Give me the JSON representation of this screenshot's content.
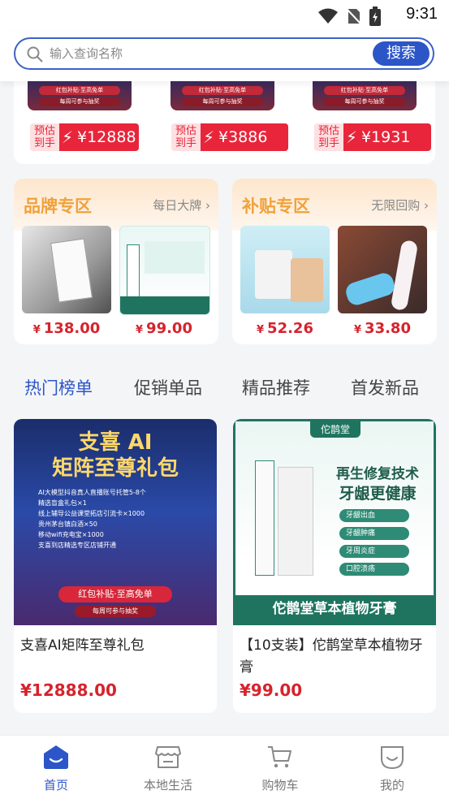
{
  "status_bar": {
    "time": "9:31"
  },
  "search": {
    "placeholder": "输入查询名称",
    "button_label": "搜索"
  },
  "top_promos": [
    {
      "pill1": "红包补贴·至高免单",
      "pill2": "每周可参与抽奖",
      "est_label": "预估到手",
      "price": "¥12888"
    },
    {
      "pill1": "红包补贴·至高免单",
      "pill2": "每周可参与抽奖",
      "est_label": "预估到手",
      "price": "¥3886"
    },
    {
      "pill1": "红包补贴·至高免单",
      "pill2": "每周可参与抽奖",
      "est_label": "预估到手",
      "price": "¥1931"
    }
  ],
  "zones": [
    {
      "title": "品牌专区",
      "link": "每日大牌",
      "items": [
        {
          "price": "138.00"
        },
        {
          "price": "99.00"
        }
      ]
    },
    {
      "title": "补贴专区",
      "link": "无限回购",
      "items": [
        {
          "price": "52.26"
        },
        {
          "price": "33.80"
        }
      ]
    }
  ],
  "currency": "¥",
  "tabs": [
    "热门榜单",
    "促销单品",
    "精品推荐",
    "首发新品"
  ],
  "products": [
    {
      "title": "支喜AI矩阵至尊礼包",
      "price": "¥12888.00",
      "banner_title_1": "支喜 AI",
      "banner_title_2": "矩阵至尊礼包",
      "lines": [
        "AI大模型抖音真人直播账号托管5-8个",
        "精选盲盒礼包×1",
        "线上辅导公益课堂拓店引流卡×1000",
        "贵州茅台镇白酒×50",
        "移动wifi充电宝×1000",
        "支喜到店精选专区店铺开通"
      ],
      "banner_btn": "红包补贴·至高免单",
      "banner_sub": "每周可参与抽奖"
    },
    {
      "title": "【10支装】佗鹊堂草本植物牙膏",
      "price": "¥99.00",
      "brand": "佗鹊堂",
      "slogan_1": "再生修复技术",
      "slogan_2": "牙龈更健康",
      "features": [
        "牙龈出血",
        "牙龈肿痛",
        "牙周炎症",
        "口腔溃疡"
      ],
      "footer": "佗鹊堂草本植物牙膏"
    }
  ],
  "bottom_nav": [
    "首页",
    "本地生活",
    "购物车",
    "我的"
  ],
  "colors": {
    "accent": "#2c55c8",
    "price_red": "#d6232d",
    "zone_orange": "#f0a23a"
  }
}
